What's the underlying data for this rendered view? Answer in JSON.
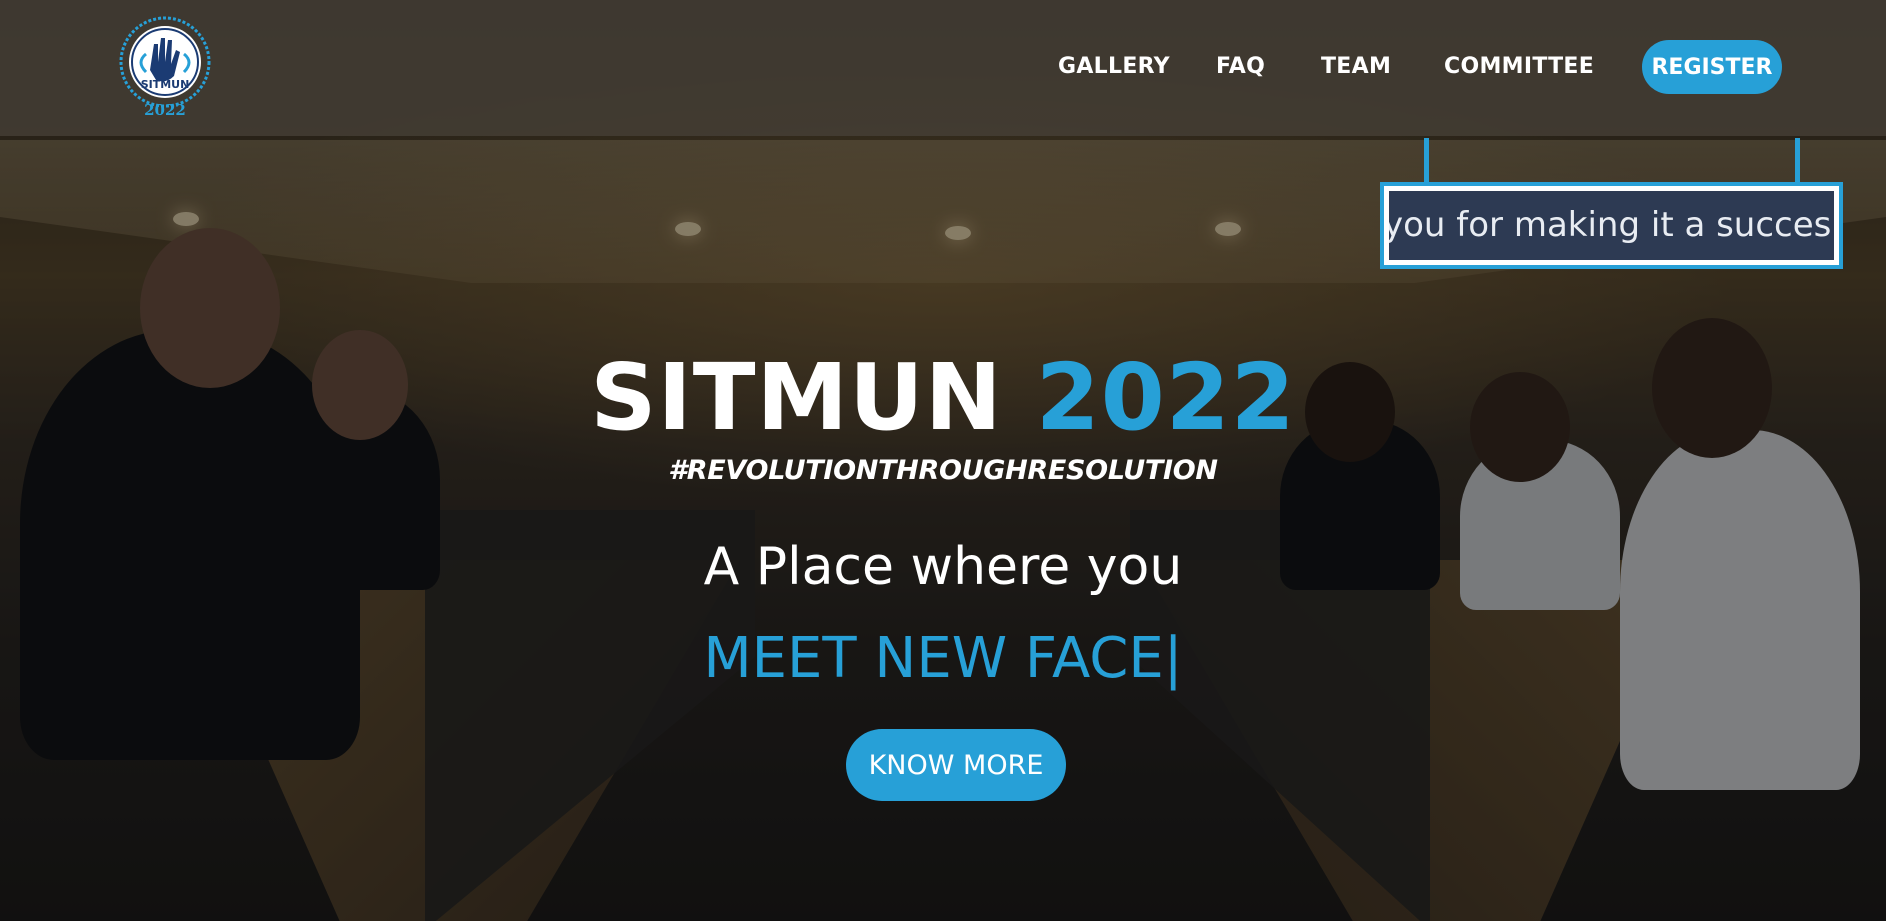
{
  "logo": {
    "year": "2022",
    "acronym": "SITMUN",
    "icon": "globe-hand-emblem-icon"
  },
  "nav": {
    "items": [
      {
        "label": "GALLERY"
      },
      {
        "label": "FAQ"
      },
      {
        "label": "TEAM"
      },
      {
        "label": "COMMITTEE"
      }
    ],
    "register_label": "REGISTER"
  },
  "ticker": {
    "text": "you for making it a succes"
  },
  "hero": {
    "title_main": "SITMUN",
    "title_year": "2022",
    "hashtag": "#REVOLUTIONTHROUGHRESOLUTION",
    "tagline": "A Place where you",
    "typed_text": "MEET NEW FACE",
    "cursor": "|",
    "cta_label": "KNOW MORE"
  },
  "colors": {
    "accent": "#27a0d7",
    "ticker_bg": "#2d3a53",
    "header_bg": "#46403a"
  }
}
